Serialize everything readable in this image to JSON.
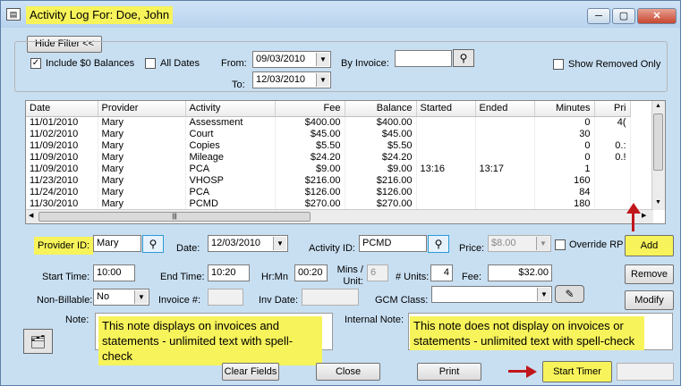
{
  "window": {
    "title": "Activity Log For: Doe, John",
    "title_icon": "app-icon",
    "controls": [
      "─",
      "▢",
      "✕"
    ]
  },
  "filter": {
    "hide_filter_label": "Hide Filter <<",
    "include_zero_label": "Include $0 Balances",
    "include_zero_checked": "✓",
    "all_dates_label": "All Dates",
    "from_label": "From:",
    "from_value": "09/03/2010",
    "to_label": "To:",
    "to_value": "12/03/2010",
    "by_invoice_label": "By Invoice:",
    "by_invoice_value": "",
    "show_removed_label": "Show Removed Only"
  },
  "grid": {
    "columns": [
      "Date",
      "Provider",
      "Activity",
      "Fee",
      "Balance",
      "Started",
      "Ended",
      "Minutes",
      "Pri"
    ],
    "rows": [
      [
        "11/01/2010",
        "Mary",
        "Assessment",
        "$400.00",
        "$400.00",
        "",
        "",
        "0",
        "4("
      ],
      [
        "11/02/2010",
        "Mary",
        "Court",
        "$45.00",
        "$45.00",
        "",
        "",
        "30",
        ""
      ],
      [
        "11/09/2010",
        "Mary",
        "Copies",
        "$5.50",
        "$5.50",
        "",
        "",
        "0",
        "0.:"
      ],
      [
        "11/09/2010",
        "Mary",
        "Mileage",
        "$24.20",
        "$24.20",
        "",
        "",
        "0",
        "0.!"
      ],
      [
        "11/09/2010",
        "Mary",
        "PCA",
        "$9.00",
        "$9.00",
        "13:16",
        "13:17",
        "1",
        ""
      ],
      [
        "11/23/2010",
        "Mary",
        "VHOSP",
        "$216.00",
        "$216.00",
        "",
        "",
        "160",
        ""
      ],
      [
        "11/24/2010",
        "Mary",
        "PCA",
        "$126.00",
        "$126.00",
        "",
        "",
        "84",
        ""
      ],
      [
        "11/30/2010",
        "Mary",
        "PCMD",
        "$270.00",
        "$270.00",
        "",
        "",
        "180",
        ""
      ]
    ],
    "hscroll_grip": "|||"
  },
  "form": {
    "provider_id_label": "Provider ID:",
    "provider_id_value": "Mary",
    "date_label": "Date:",
    "date_value": "12/03/2010",
    "activity_id_label": "Activity ID:",
    "activity_id_value": "PCMD",
    "price_label": "Price:",
    "price_value": "$8.00",
    "override_label": "Override RP",
    "add_label": "Add",
    "start_time_label": "Start Time:",
    "start_time_value": "10:00",
    "end_time_label": "End Time:",
    "end_time_value": "10:20",
    "hrmn_label": "Hr:Mn",
    "hrmn_value": "00:20",
    "mins_unit_label1": "Mins /",
    "mins_unit_label2": "Unit:",
    "mins_unit_value": "6",
    "units_label": "# Units:",
    "units_value": "4",
    "fee_label": "Fee:",
    "fee_value": "$32.00",
    "remove_label": "Remove",
    "non_billable_label": "Non-Billable:",
    "non_billable_value": "No",
    "invoice_label": "Invoice #:",
    "invoice_value": "",
    "inv_date_label": "Inv Date:",
    "inv_date_value": "",
    "gcm_class_label": "GCM Class:",
    "gcm_class_value": "",
    "modify_label": "Modify",
    "note_label": "Note:",
    "note_text": "This note displays on invoices and statements - unlimited text with spell-check",
    "internal_note_label": "Internal Note:",
    "internal_note_text": "This note does not display on invoices or statements - unlimited text with spell-check"
  },
  "footer": {
    "clear_fields": "Clear Fields",
    "close": "Close",
    "print": "Print",
    "start_timer": "Start Timer"
  },
  "colors": {
    "highlight": "#f7f35a",
    "arrow": "#c0161c"
  }
}
